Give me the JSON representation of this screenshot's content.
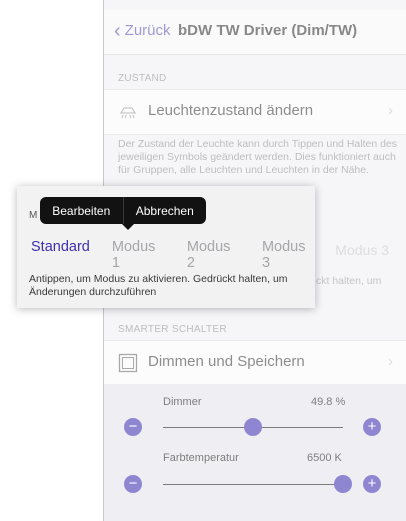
{
  "navbar": {
    "back_label": "Zurück",
    "title": "bDW TW Driver (Dim/TW)"
  },
  "zustand": {
    "header": "ZUSTAND",
    "row_label": "Leuchtenzustand ändern",
    "description": "Der Zustand der Leuchte kann durch Tippen und Halten des jeweiligen Symbols geändert werden. Dies funktioniert auch für Gruppen, alle Leuchten und Leuchten in der Nähe."
  },
  "background_modes": {
    "ghost_mode": "Modus 3",
    "ghost_text": "ckt halten, um"
  },
  "popup": {
    "header": "M",
    "modes": [
      "Standard",
      "Modus 1",
      "Modus 2",
      "Modus 3"
    ],
    "active_mode": "Standard",
    "description": "Antippen, um Modus zu aktivieren. Gedrückt halten, um Änderungen durchzuführen"
  },
  "tooltip": {
    "edit_label": "Bearbeiten",
    "cancel_label": "Abbrechen"
  },
  "smart_switch": {
    "header": "SMARTER SCHALTER",
    "row_label": "Dimmen und Speichern"
  },
  "sliders": {
    "dimmer": {
      "label": "Dimmer",
      "value_text": "49.8 %",
      "fraction": 0.498
    },
    "color_temp": {
      "label": "Farbtemperatur",
      "value_text": "6500 K",
      "fraction": 1.0
    }
  },
  "colors": {
    "accent": "#3f2fb0",
    "back_link": "#5b4fb5"
  }
}
